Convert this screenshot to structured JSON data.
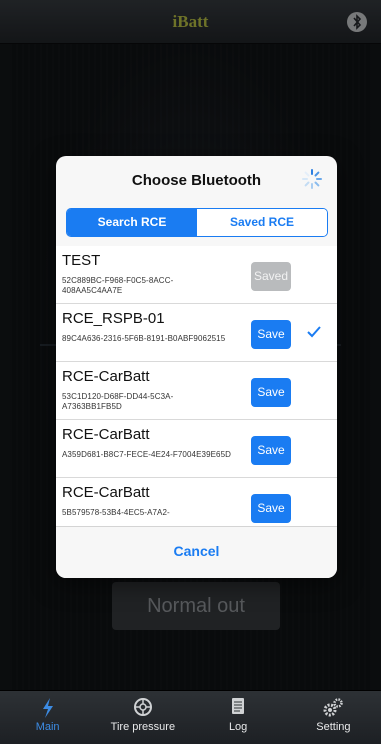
{
  "app": {
    "title": "iBatt",
    "bluetooth_icon": "bluetooth-icon"
  },
  "background": {
    "normal_out_label": "Normal out"
  },
  "modal": {
    "title": "Choose Bluetooth",
    "tabs": [
      {
        "label": "Search RCE",
        "selected": true
      },
      {
        "label": "Saved RCE",
        "selected": false
      }
    ],
    "devices": [
      {
        "name": "TEST",
        "id": "52C889BC-F968-F0C5-8ACC-408AA5C4AA7E",
        "button": "Saved",
        "button_enabled": false,
        "checked": false
      },
      {
        "name": "RCE_RSPB-01",
        "id": "89C4A636-2316-5F6B-8191-B0ABF9062515",
        "button": "Save",
        "button_enabled": true,
        "checked": true
      },
      {
        "name": "RCE-CarBatt",
        "id": "53C1D120-D68F-DD44-5C3A-A7363BB1FB5D",
        "button": "Save",
        "button_enabled": true,
        "checked": false
      },
      {
        "name": "RCE-CarBatt",
        "id": "A359D681-B8C7-FECE-4E24-F7004E39E65D",
        "button": "Save",
        "button_enabled": true,
        "checked": false
      },
      {
        "name": "RCE-CarBatt",
        "id": "5B579578-53B4-4EC5-A7A2-",
        "button": "Save",
        "button_enabled": true,
        "checked": false
      }
    ],
    "cancel_label": "Cancel"
  },
  "tabbar": {
    "items": [
      {
        "label": "Main",
        "icon": "lightning-icon",
        "active": true
      },
      {
        "label": "Tire pressure",
        "icon": "tire-icon",
        "active": false
      },
      {
        "label": "Log",
        "icon": "document-icon",
        "active": false
      },
      {
        "label": "Setting",
        "icon": "gears-icon",
        "active": false
      }
    ]
  },
  "colors": {
    "accent": "#1a7cf2",
    "title": "#c9d14a",
    "disabled": "#b9bbbd"
  }
}
